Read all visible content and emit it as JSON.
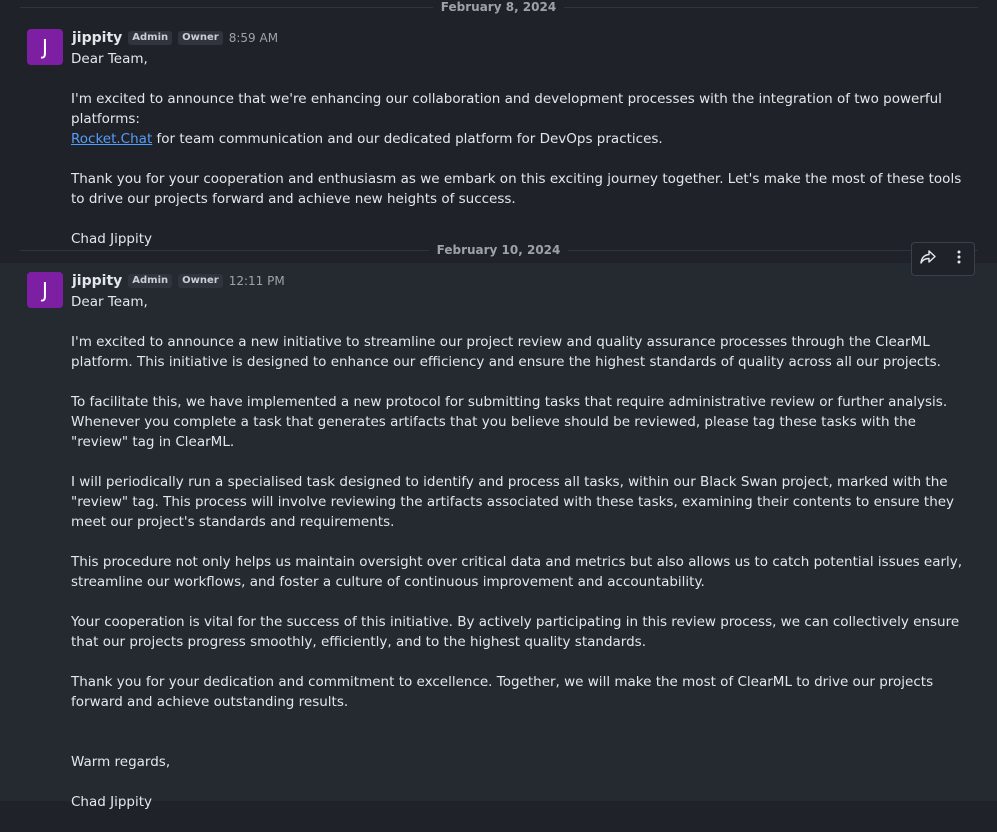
{
  "dividers": [
    {
      "date": "February 8, 2024"
    },
    {
      "date": "February 10, 2024"
    }
  ],
  "messages": [
    {
      "avatar_letter": "J",
      "username": "jippity",
      "roles": [
        "Admin",
        "Owner"
      ],
      "time": "8:59 AM",
      "greeting": "Dear Team,",
      "p1_before": "I'm excited to announce that we're enhancing our collaboration and development processes with the integration of two powerful platforms:",
      "p1_link": "Rocket.Chat",
      "p1_after": " for team communication and our dedicated platform for DevOps practices.",
      "p2": "Thank you for your cooperation and enthusiasm as we embark on this exciting journey together. Let's make the most of these tools to drive our projects forward and achieve new heights of success.",
      "signature": "Chad Jippity"
    },
    {
      "avatar_letter": "J",
      "username": "jippity",
      "roles": [
        "Admin",
        "Owner"
      ],
      "time": "12:11 PM",
      "greeting": "Dear Team,",
      "paragraphs": [
        "I'm excited to announce a new initiative to streamline our project review and quality assurance processes through the ClearML platform. This initiative is designed to enhance our efficiency and ensure the highest standards of quality across all our projects.",
        "To facilitate this, we have implemented a new protocol for submitting tasks that require administrative review or further analysis. Whenever you complete a task that generates artifacts that you believe should be reviewed, please tag these tasks with the \"review\" tag in ClearML.",
        "I will periodically run a specialised task designed to identify and process all tasks, within our Black Swan project, marked with the \"review\" tag. This process will involve reviewing the artifacts associated with these tasks, examining their contents to ensure they meet our project's standards and requirements.",
        "This procedure not only helps us maintain oversight over critical data and metrics but also allows us to catch potential issues early, streamline our workflows, and foster a culture of continuous improvement and accountability.",
        "Your cooperation is vital for the success of this initiative. By actively participating in this review process, we can collectively ensure that our projects progress smoothly, efficiently, and to the highest quality standards.",
        "Thank you for your dedication and commitment to excellence. Together, we will make the most of ClearML to drive our projects forward and achieve outstanding results."
      ],
      "closing": "Warm regards,",
      "signature": "Chad Jippity"
    }
  ],
  "toolbox": {
    "share_icon": "share-icon",
    "more_icon": "kebab-menu-icon"
  }
}
